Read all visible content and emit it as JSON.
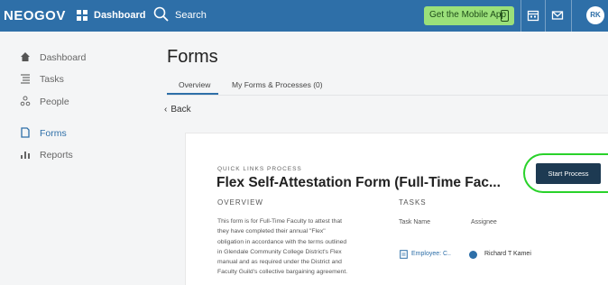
{
  "header": {
    "logo": "NEOGOV",
    "dashboard": "Dashboard",
    "search": "Search",
    "mobile_app": "Get the Mobile App",
    "avatar_initials": "RK",
    "color": "#2e6fa8"
  },
  "sidebar": {
    "items": [
      {
        "label": "Dashboard",
        "icon": "home-icon"
      },
      {
        "label": "Tasks",
        "icon": "tasks-icon"
      },
      {
        "label": "People",
        "icon": "people-icon"
      },
      {
        "label": "Forms",
        "icon": "forms-icon",
        "active": true
      },
      {
        "label": "Reports",
        "icon": "reports-icon"
      }
    ]
  },
  "main": {
    "title": "Forms",
    "tabs": [
      {
        "label": "Overview",
        "active": true
      },
      {
        "label": "My Forms & Processes (0)"
      }
    ],
    "back": "Back"
  },
  "card": {
    "kicker": "QUICK LINKS PROCESS",
    "title": "Flex Self-Attestation Form (Full-Time Fac...",
    "overview_heading": "OVERVIEW",
    "overview_lines": [
      "This form is for Full-Time Faculty  to attest that",
      "they have completed their annual \"Flex\"",
      "obligation in accordance with the terms outlined",
      "in Glendale Community College District's Flex",
      "manual and as required under the District and",
      "Faculty Guild's collective bargaining agreement."
    ],
    "tasks_heading": "TASKS",
    "task_name_header": "Task Name",
    "assignee_header": "Assignee",
    "task_name": "Employee: C..",
    "assignee": "Richard T Kamei",
    "start_button": "Start Process"
  }
}
